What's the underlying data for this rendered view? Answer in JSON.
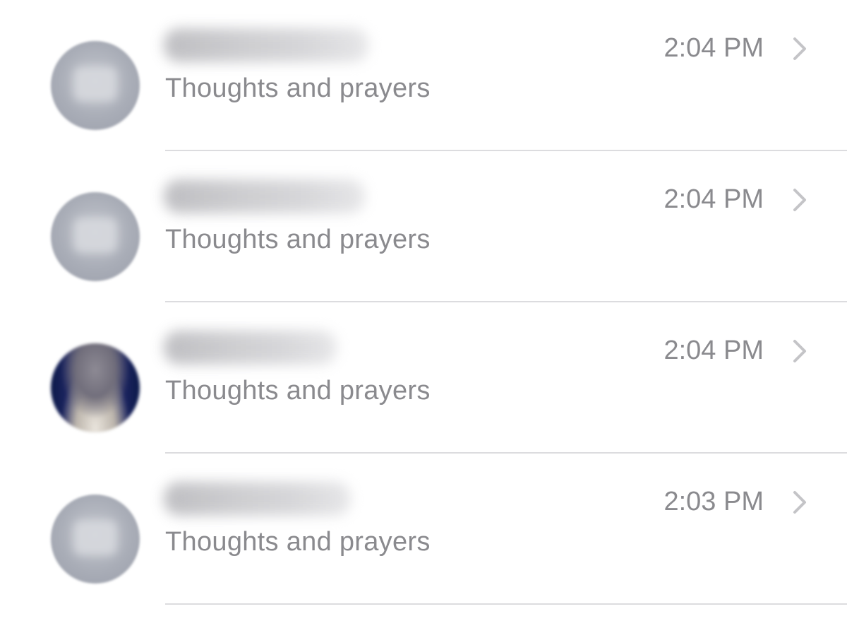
{
  "conversations": [
    {
      "preview": "Thoughts and prayers",
      "time": "2:04 PM",
      "avatar": "default-contact-icon"
    },
    {
      "preview": "Thoughts and prayers",
      "time": "2:04 PM",
      "avatar": "default-contact-icon"
    },
    {
      "preview": "Thoughts and prayers",
      "time": "2:04 PM",
      "avatar": "photo"
    },
    {
      "preview": "Thoughts and prayers",
      "time": "2:03 PM",
      "avatar": "default-contact-icon"
    }
  ],
  "colors": {
    "text_secondary": "#8a8a8e",
    "divider": "#dcdcdf",
    "chevron": "#c4c4c7",
    "avatar_default": "#a9adb7"
  }
}
